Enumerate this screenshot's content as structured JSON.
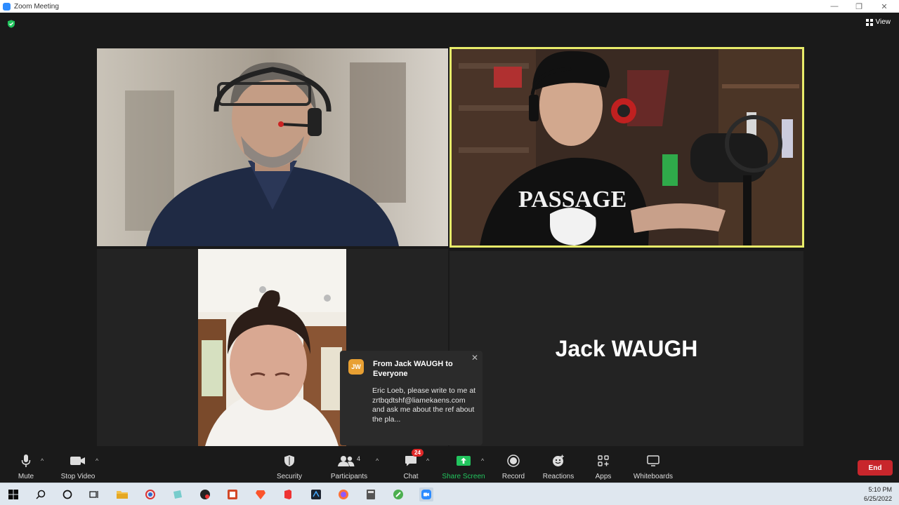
{
  "window": {
    "title": "Zoom Meeting"
  },
  "view": {
    "label": "View"
  },
  "tiles": {
    "active_speaker_name": "Jack WAUGH",
    "shirt_text": "PASSAGE"
  },
  "chat_notification": {
    "avatar_initials": "JW",
    "from": "From Jack WAUGH to Everyone",
    "message": "Eric Loeb, please write to me at zrtbqdtshf@liamekaens.com and ask me about the ref about the pla..."
  },
  "toolbar": {
    "mute_label": "Mute",
    "stop_video_label": "Stop Video",
    "security_label": "Security",
    "participants_label": "Participants",
    "participants_count": "4",
    "chat_label": "Chat",
    "chat_badge": "24",
    "share_screen_label": "Share Screen",
    "record_label": "Record",
    "reactions_label": "Reactions",
    "apps_label": "Apps",
    "whiteboards_label": "Whiteboards",
    "end_label": "End"
  },
  "taskbar": {
    "time": "5:10 PM",
    "date": "6/25/2022"
  },
  "colors": {
    "active_speaker_border": "#e8ec6a",
    "share_green": "#22c55e",
    "end_red": "#c8262c",
    "chat_badge_red": "#e02828"
  }
}
